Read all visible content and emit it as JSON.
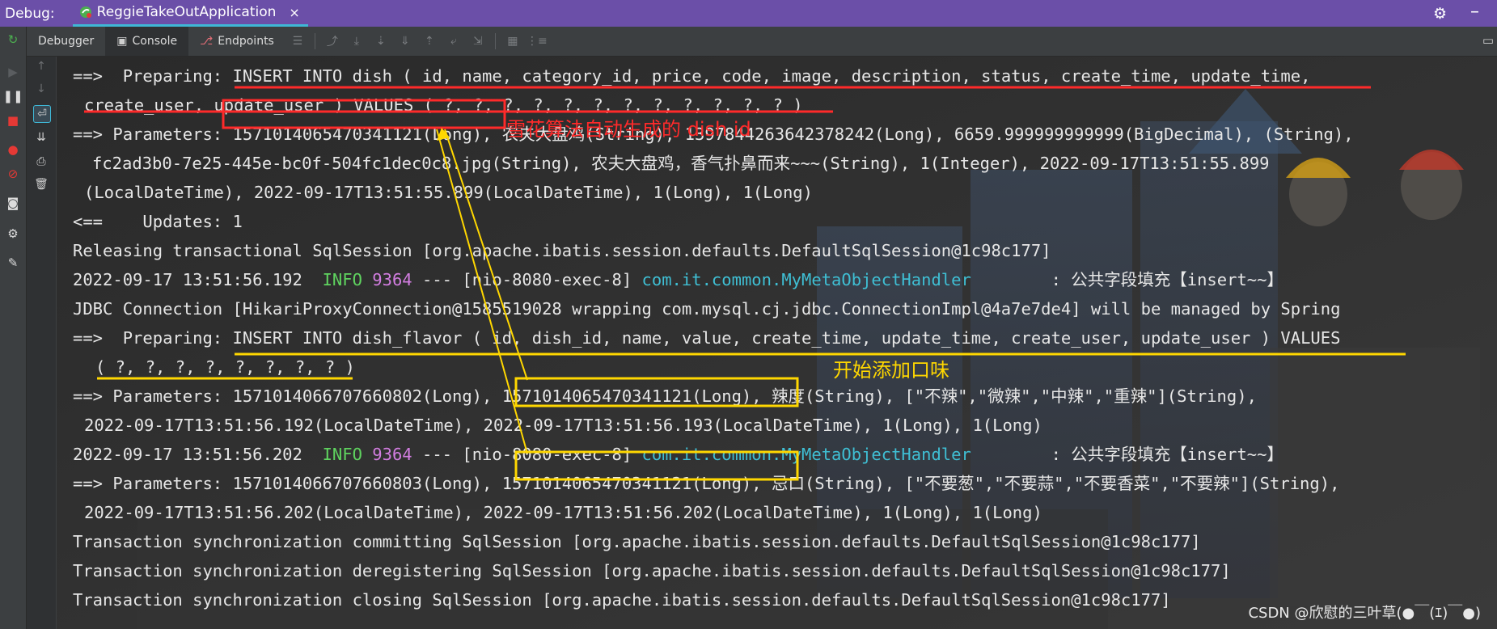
{
  "titlebar": {
    "debug_label": "Debug:",
    "run_config": "ReggieTakeOutApplication",
    "close_glyph": "×"
  },
  "toolbar": {
    "tabs": [
      {
        "label": "Debugger",
        "icon": "debugger-icon"
      },
      {
        "label": "Console",
        "icon": "console-icon"
      },
      {
        "label": "Endpoints",
        "icon": "endpoints-icon"
      }
    ]
  },
  "console": {
    "line1_prefix": "==>  Preparing: ",
    "line1_sql": "INSERT INTO dish ( id, name, category_id, price, code, image, description, status, create_time, update_time,",
    "line2": "create_user, update_user ) VALUES ( ?, ?, ?, ?, ?, ?, ?, ?, ?, ?, ?, ? )",
    "line3_prefix": "==> Parameters: ",
    "line3_id": "1571014065470341121(Long)",
    "line3_rest": ", 农夫大盘鸡(String), 1397844263642378242(Long), 6659.999999999999(BigDecimal), (String),",
    "line4": "fc2ad3b0-7e25-445e-bc0f-504fc1dec0c8.jpg(String), 农夫大盘鸡，香气扑鼻而来~~~(String), 1(Integer), 2022-09-17T13:51:55.899",
    "line5": "(LocalDateTime), 2022-09-17T13:51:55.899(LocalDateTime), 1(Long), 1(Long)",
    "line6": "<==    Updates: 1",
    "line7": "Releasing transactional SqlSession [org.apache.ibatis.session.defaults.DefaultSqlSession@1c98c177]",
    "line8_time": "2022-09-17 13:51:56.192  ",
    "line8_level": "INFO",
    "line8_pid": "9364",
    "line8_thread": " --- [nio-8080-exec-8] ",
    "line8_class": "com.it.common.MyMetaObjectHandler",
    "line8_msg": "        : 公共字段填充【insert~~】",
    "line9": "JDBC Connection [HikariProxyConnection@1585519028 wrapping com.mysql.cj.jdbc.ConnectionImpl@4a7e7de4] will be managed by Spring",
    "line10_prefix": "==>  Preparing: ",
    "line10_sql": "INSERT INTO dish_flavor ( id, dish_id, name, value, create_time, update_time, create_user, update_user ) VALUES",
    "line11": "( ?, ?, ?, ?, ?, ?, ?, ? )",
    "line12_prefix": "==> Parameters: 1571014066707660802(Long), ",
    "line12_id": "1571014065470341121(Long)",
    "line12_rest": ", 辣度(String), [\"不辣\",\"微辣\",\"中辣\",\"重辣\"](String), ",
    "line13": "2022-09-17T13:51:56.192(LocalDateTime), 2022-09-17T13:51:56.193(LocalDateTime), 1(Long), 1(Long)",
    "line14_time": "2022-09-17 13:51:56.202  ",
    "line14_level": "INFO",
    "line14_pid": "9364",
    "line14_thread": " --- [nio-8080-exec-8] ",
    "line14_class": "com.it.common.MyMetaObjectHandler",
    "line14_msg": "        : 公共字段填充【insert~~】",
    "line15_prefix": "==> Parameters: 1571014066707660803(Long), ",
    "line15_id": "1571014065470341121(Long)",
    "line15_rest": ", 忌口(String), [\"不要葱\",\"不要蒜\",\"不要香菜\",\"不要辣\"](String),",
    "line16": "2022-09-17T13:51:56.202(LocalDateTime), 2022-09-17T13:51:56.202(LocalDateTime), 1(Long), 1(Long)",
    "line17": "Transaction synchronization committing SqlSession [org.apache.ibatis.session.defaults.DefaultSqlSession@1c98c177]",
    "line18": "Transaction synchronization deregistering SqlSession [org.apache.ibatis.session.defaults.DefaultSqlSession@1c98c177]",
    "line19": "Transaction synchronization closing SqlSession [org.apache.ibatis.session.defaults.DefaultSqlSession@1c98c177]"
  },
  "annotations": {
    "red_note": "雪花算法自动生成的 dish id",
    "yellow_note": "开始添加口味"
  },
  "watermark": "CSDN @欣慰的三叶草(●￣(ｴ)￣●)",
  "colors": {
    "titlebar": "#6b4fa8",
    "red_annotation": "#ff2a2a",
    "yellow_annotation": "#ffd700",
    "info": "#5fd35f",
    "class_link": "#3fbfd4"
  }
}
